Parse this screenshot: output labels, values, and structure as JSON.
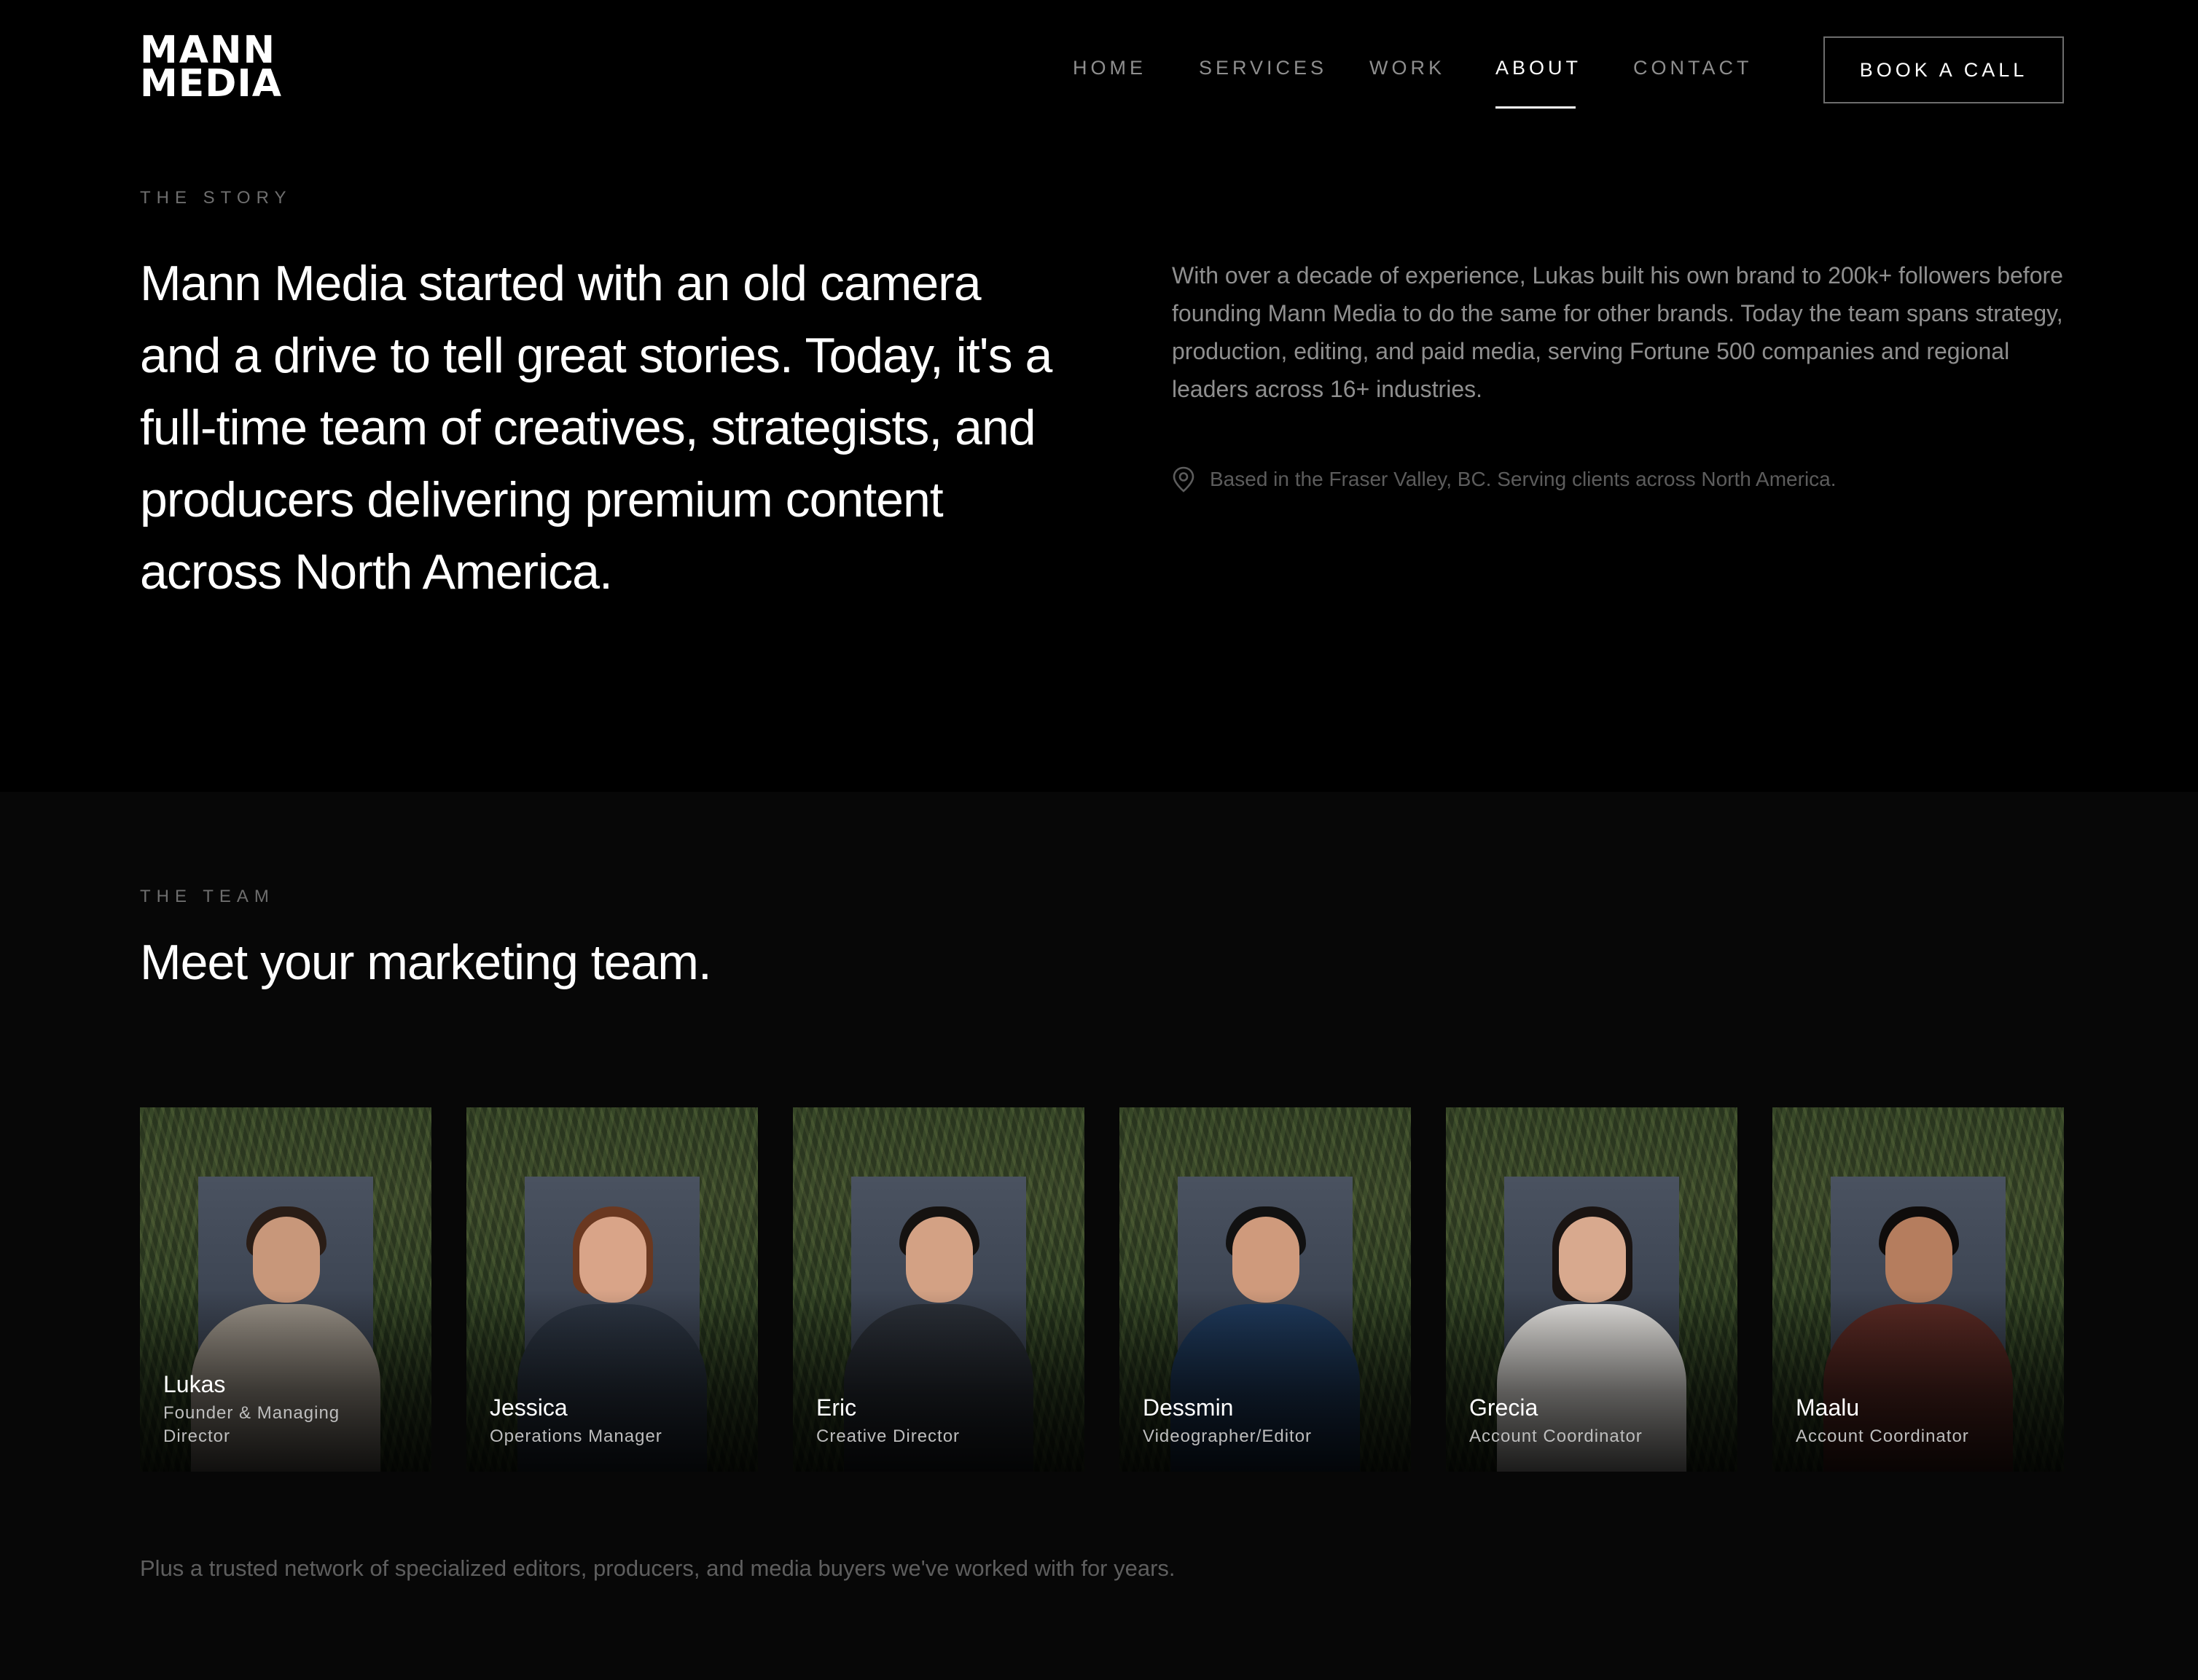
{
  "header": {
    "logo": {
      "line1": "MANN",
      "line2": "MEDIA"
    },
    "nav": [
      {
        "label": "HOME",
        "active": false
      },
      {
        "label": "SERVICES",
        "active": false
      },
      {
        "label": "WORK",
        "active": false
      },
      {
        "label": "ABOUT",
        "active": true
      },
      {
        "label": "CONTACT",
        "active": false
      }
    ],
    "cta_label": "BOOK A CALL"
  },
  "story": {
    "eyebrow": "THE STORY",
    "heading": "Mann Media started with an old camera and a drive to tell great stories. Today, it's a full-time team of creatives, strategists, and producers delivering premium content across North America.",
    "body": "With over a decade of experience, Lukas built his own brand to 200k+ followers before founding Mann Media to do the same for other brands. Today the team spans strategy, production, editing, and paid media, serving Fortune 500 companies and regional leaders across 16+ industries.",
    "location_icon": "map-pin-icon",
    "location": "Based in the Fraser Valley, BC. Serving clients across North America."
  },
  "team": {
    "eyebrow": "THE TEAM",
    "heading": "Meet your marketing team.",
    "members": [
      {
        "name": "Lukas",
        "role": "Founder & Managing Director"
      },
      {
        "name": "Jessica",
        "role": "Operations Manager"
      },
      {
        "name": "Eric",
        "role": "Creative Director"
      },
      {
        "name": "Dessmin",
        "role": "Videographer/Editor"
      },
      {
        "name": "Grecia",
        "role": "Account Coordinator"
      },
      {
        "name": "Maalu",
        "role": "Account Coordinator"
      }
    ],
    "footnote": "Plus a trusted network of specialized editors, producers, and media buyers we've worked with for years."
  },
  "colors": {
    "background": "#000000",
    "team_background": "#070707",
    "muted_text": "#8f8f8f",
    "dim_text": "#5e5e5e"
  }
}
